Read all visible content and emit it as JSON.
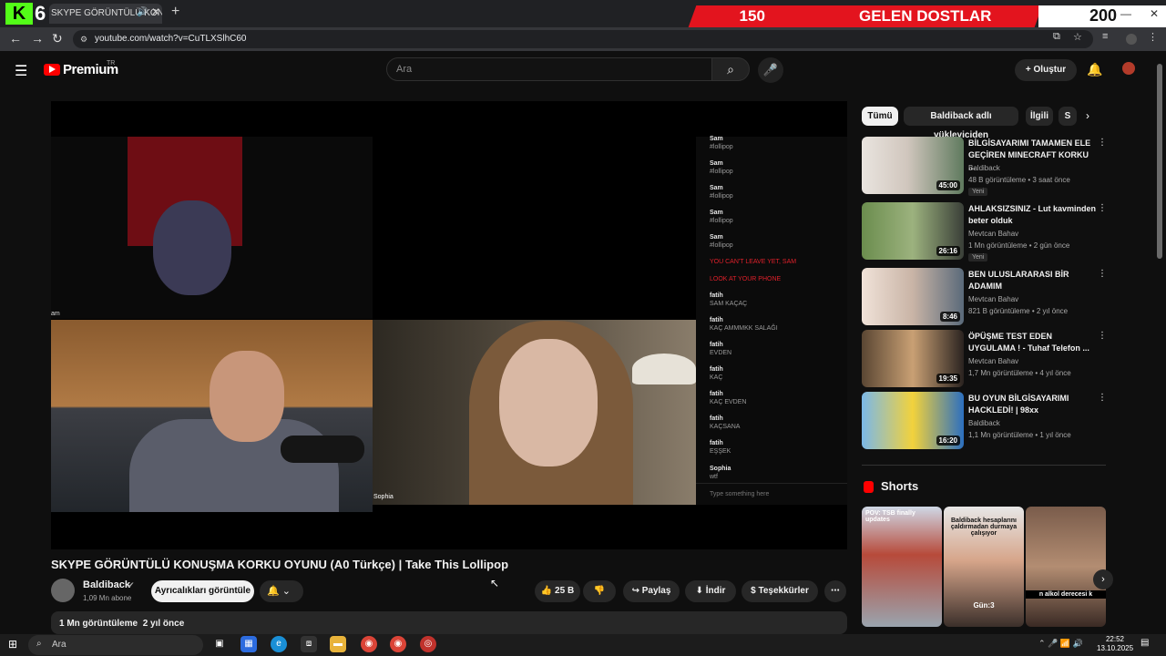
{
  "stream_overlay": {
    "logo_letter": "K",
    "viewer_count": "6",
    "banner_left": "150",
    "banner_label": "GELEN DOSTLAR",
    "banner_right": "200"
  },
  "browser": {
    "tab_title": "SKYPE GÖRÜNTÜLÜ KONU",
    "url": "youtube.com/watch?v=CuTLXSlhC60",
    "icons": [
      "back-icon",
      "forward-icon",
      "reload-icon",
      "site-info-icon",
      "new-tab-icon",
      "close-icon",
      "audio-icon"
    ]
  },
  "header": {
    "brand": "Premium",
    "region": "TR",
    "search_placeholder": "Ara",
    "create_label": "Oluştur"
  },
  "player": {
    "participants": [
      "am",
      "Sophia"
    ],
    "chat": [
      {
        "name": "Sam",
        "text": "#lollipop"
      },
      {
        "name": "Sam",
        "text": "#lollipop"
      },
      {
        "name": "Sam",
        "text": "#lollipop"
      },
      {
        "name": "Sam",
        "text": "#lollipop"
      },
      {
        "name": "Sam",
        "text": "#lollipop"
      },
      {
        "name": "",
        "text": "YOU CAN'T LEAVE YET, SAM",
        "alert": true
      },
      {
        "name": "",
        "text": "LOOK AT YOUR PHONE",
        "alert": true
      },
      {
        "name": "fatih",
        "text": "SAM KAÇAÇ"
      },
      {
        "name": "fatih",
        "text": "KAÇ AMMMKK SALAĞI"
      },
      {
        "name": "fatih",
        "text": "EVDEN"
      },
      {
        "name": "fatih",
        "text": "KAÇ"
      },
      {
        "name": "fatih",
        "text": "KAÇ EVDEN"
      },
      {
        "name": "fatih",
        "text": "KAÇSANA"
      },
      {
        "name": "fatih",
        "text": "EŞŞEK"
      },
      {
        "name": "Sophia",
        "text": "wtf"
      }
    ],
    "chat_placeholder": "Type something here"
  },
  "video": {
    "title": "SKYPE GÖRÜNTÜLÜ KONUŞMA KORKU OYUNU (A0 Türkçe) | Take This Lollipop",
    "channel": "Baldiback",
    "subscribers": "1,09 Mn abone",
    "join_label": "Ayrıcalıkları görüntüle",
    "likes": "25 B",
    "share_label": "Paylaş",
    "download_label": "İndir",
    "thanks_label": "Teşekkürler",
    "views": "1 Mn görüntüleme",
    "age": "2 yıl önce"
  },
  "sidebar": {
    "chips": [
      "Tümü",
      "Baldiback adlı yükleyiciden",
      "İlgili",
      "S"
    ],
    "recommendations": [
      {
        "title": "BİLGİSAYARIMI TAMAMEN ELE GEÇİREN MINECRAFT KORKU ...",
        "channel": "Baldiback",
        "views": "48 B görüntüleme",
        "age": "3 saat önce",
        "duration": "45:00",
        "badge": "Yeni"
      },
      {
        "title": "AHLAKSIZSINIZ - Lut kavminden beter olduk",
        "channel": "Mevtcan Bahav",
        "views": "1 Mn görüntüleme",
        "age": "2 gün önce",
        "duration": "26:16",
        "badge": "Yeni"
      },
      {
        "title": "BEN ULUSLARARASI BİR ADAMIM",
        "channel": "Mevtcan Bahav",
        "views": "821 B görüntüleme",
        "age": "2 yıl önce",
        "duration": "8:46",
        "badge": ""
      },
      {
        "title": "ÖPÜŞME TEST EDEN UYGULAMA ! - Tuhaf Telefon ...",
        "channel": "Mevtcan Bahav",
        "views": "1,7 Mn görüntüleme",
        "age": "4 yıl önce",
        "duration": "19:35",
        "badge": ""
      },
      {
        "title": "BU OYUN BİLGİSAYARIMI HACKLEDİ! | 98xx",
        "channel": "Baldiback",
        "views": "1,1 Mn görüntüleme",
        "age": "1 yıl önce",
        "duration": "16:20",
        "badge": ""
      }
    ],
    "shorts_title": "Shorts",
    "shorts": [
      {
        "caption": "POV: TSB finally updates"
      },
      {
        "caption": "Baldiback hesaplarını çaldırmadan durmaya çalışıyor"
      },
      {
        "caption": "n alkol derecesi k"
      }
    ],
    "short_overlay_text": "Gün:3"
  },
  "taskbar": {
    "search_label": "Ara",
    "time": "22:52",
    "date": "13.10.2025"
  }
}
